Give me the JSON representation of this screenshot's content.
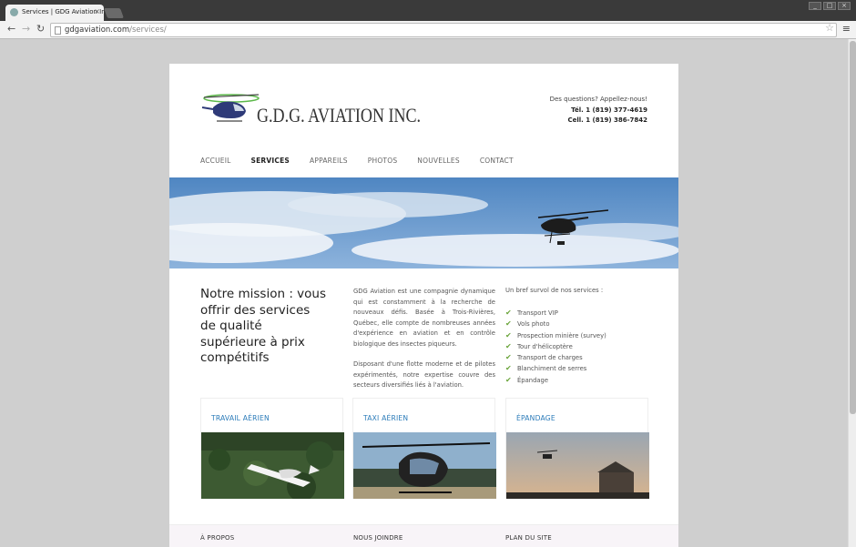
{
  "browser": {
    "tab_title": "Services | GDG Aviation Inc.",
    "tab_close": "×",
    "url_domain": "gdgaviation.com",
    "url_path": "/services/",
    "back_icon": "←",
    "forward_icon": "→",
    "reload_icon": "↻",
    "star_icon": "☆",
    "menu_icon": "≡",
    "win_min": "_",
    "win_max": "□",
    "win_close": "×"
  },
  "header": {
    "logo_text": "G.D.G. AVIATION INC.",
    "question": "Des questions? Appellez-nous!",
    "tel": "Tél. 1 (819) 377-4619",
    "cell": "Cell. 1 (819) 386-7842"
  },
  "nav": [
    "ACCUEIL",
    "SERVICES",
    "APPAREILS",
    "PHOTOS",
    "NOUVELLES",
    "CONTACT"
  ],
  "mission": "Notre mission : vous offrir des services de qualité supérieure à prix compétitifs",
  "description": [
    "GDG Aviation est une compagnie dynamique qui est constamment à la recherche de nouveaux défis. Basée à Trois-Rivières, Québec, elle compte de nombreuses années d'expérience en aviation et en contrôle biologique des insectes piqueurs.",
    "Disposant d'une flotte moderne et de pilotes expérimentés, notre expertise couvre des secteurs diversifiés liés à l'aviation."
  ],
  "services": {
    "intro": "Un bref survol de nos services :",
    "items": [
      "Transport VIP",
      "Vols photo",
      "Prospection minière (survey)",
      "Tour d'hélicoptère",
      "Transport de charges",
      "Blanchiment de serres",
      "Épandage"
    ]
  },
  "cards": [
    "TRAVAIL AÉRIEN",
    "TAXI AÉRIEN",
    "ÉPANDAGE"
  ],
  "footer": [
    "À PROPOS",
    "NOUS JOINDRE",
    "PLAN DU SITE"
  ],
  "colors": {
    "link": "#2b7bb9",
    "check": "#6aa43a",
    "sky": "#5a8fc4"
  }
}
